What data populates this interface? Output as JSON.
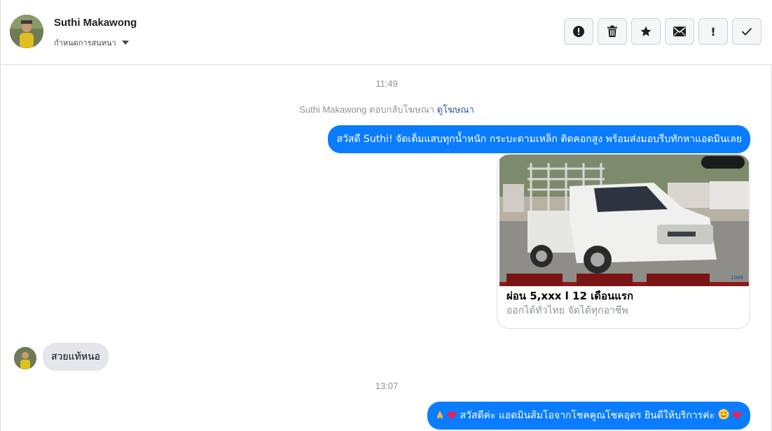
{
  "header": {
    "contact_name": "Suthi Makawong",
    "status_label": "กำหนดการสนทนา",
    "toolbar": [
      {
        "name": "report-icon",
        "label": ""
      },
      {
        "name": "trash-icon",
        "label": ""
      },
      {
        "name": "star-icon",
        "label": ""
      },
      {
        "name": "envelope-icon",
        "label": ""
      },
      {
        "name": "exclamation-icon",
        "label": "!"
      },
      {
        "name": "checkmark-icon",
        "label": ""
      }
    ]
  },
  "thread": {
    "time_1": "11:49",
    "reply_note": {
      "text": "Suthi Makawong ตอบกลับโฆษณา",
      "link": "ดูโฆษณา"
    },
    "msg_out_1": "สวัสดี Suthi! จัดเต็มแสบทุกน้ำหนัก กระบะดามเหล็ก ติดคอกสูง พร้อมส่งมอบรีบทักหาแอดมินเลย",
    "ad_card": {
      "title": "ผ่อน 5,xxx l 12 เดือนแรก",
      "subtitle": "ออกได้ทั่วไทย จัดได้ทุกอาชีพ",
      "image_watermark": "1009"
    },
    "msg_in_1": "สวยแท้หนอ",
    "time_2": "13:07",
    "msg_out_2": "สวัสดีค่ะ แอดมินส้มโอจากโชคคูณโชคอุดร ยินดีให้บริการค่ะ"
  },
  "colors": {
    "accent_blue": "#0a7cff",
    "incoming_bubble": "#e4e6eb",
    "link": "#385898",
    "muted": "#90949c"
  }
}
